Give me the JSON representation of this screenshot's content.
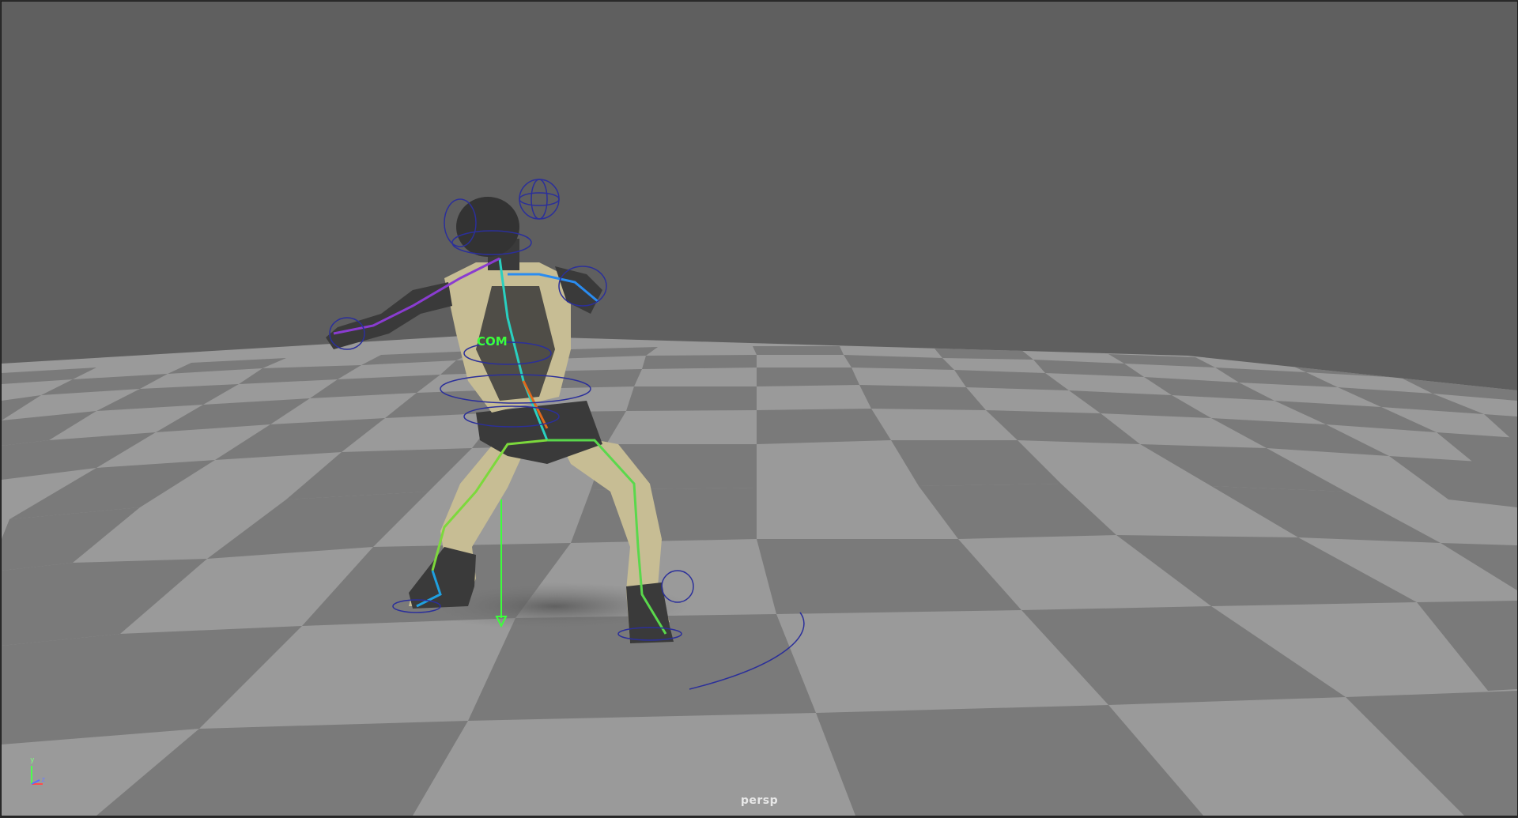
{
  "viewport": {
    "camera_name": "persp",
    "com_control_label": "COM",
    "axis_y_letter": "y",
    "axis_z_letter": "z"
  },
  "colors": {
    "background": "#5f5f5f",
    "grid_light": "#999999",
    "grid_dark": "#7a7a7a",
    "control_curve": "#2b2f9a",
    "com_label": "#3cff3c",
    "suit_tan": "#c7bd94",
    "body_dark": "#3a3a3a"
  },
  "icons": {
    "axis_gizmo": "xyz-axis-icon"
  }
}
